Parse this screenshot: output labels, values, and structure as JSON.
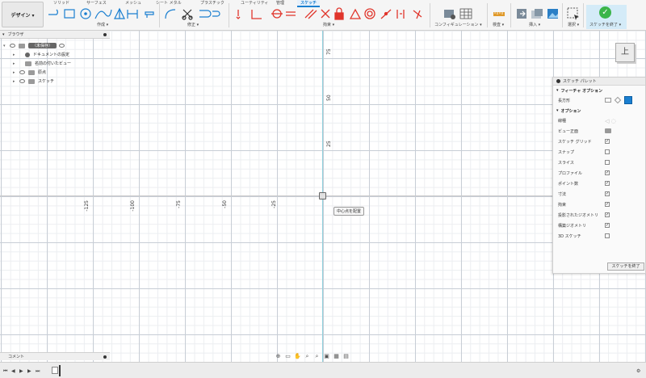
{
  "toolbar": {
    "workspace": "デザイン ▾",
    "tabs": [
      "ソリッド",
      "サーフェス",
      "メッシュ",
      "シート メタル",
      "プラスチック",
      "ユーティリティ",
      "管理",
      "スケッチ"
    ],
    "active_tab": "スケッチ",
    "groups": [
      "作成 ▾",
      "修正 ▾",
      "拘束 ▾",
      "コンフィギュレーション ▾",
      "検査 ▾",
      "挿入 ▾",
      "選択 ▾",
      "スケッチを終了 ▾"
    ],
    "top_view_label": "上"
  },
  "browser": {
    "title": "ブラウザ",
    "root_item": "（未保存）",
    "items": [
      "ドキュメントの設定",
      "名前の付いたビュー",
      "原点",
      "スケッチ"
    ]
  },
  "canvas": {
    "y_labels": [
      "75",
      "50",
      "25"
    ],
    "x_labels": [
      "-125",
      "-100",
      "-75",
      "-50",
      "-25"
    ],
    "tooltip": "中心点を配置"
  },
  "palette": {
    "title": "スケッチ パレット",
    "feature_options_header": "フィーチャ オプション",
    "rect_label": "長方形",
    "options_header": "オプション",
    "rows": [
      {
        "label": "線種",
        "type": "icon"
      },
      {
        "label": "ビュー正面",
        "type": "icon"
      },
      {
        "label": "スケッチ グリッド",
        "checked": "✓"
      },
      {
        "label": "スナップ",
        "checked": ""
      },
      {
        "label": "スライス",
        "checked": ""
      },
      {
        "label": "プロファイル",
        "checked": "✓"
      },
      {
        "label": "ポイント数",
        "checked": "✓"
      },
      {
        "label": "寸法",
        "checked": "✓"
      },
      {
        "label": "拘束",
        "checked": "✓"
      },
      {
        "label": "投影されたジオメトリ",
        "checked": "✓"
      },
      {
        "label": "構築ジオメトリ",
        "checked": "✓"
      },
      {
        "label": "3D スケッチ",
        "checked": ""
      }
    ],
    "finish_button": "スケッチを終了"
  },
  "comments": {
    "title": "コメント"
  },
  "colors": {
    "accent": "#1a7fd0",
    "constraint_red": "#e0352b",
    "finish_green": "#3bb54a"
  }
}
